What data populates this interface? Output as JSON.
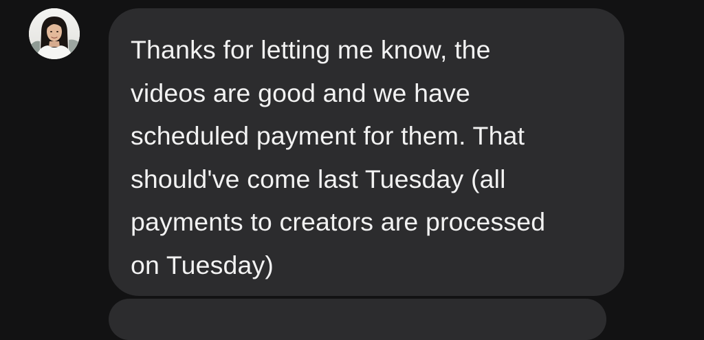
{
  "conversation": {
    "message": {
      "sender_avatar": "avatar-photo-icon",
      "text": "Thanks for letting me know, the\nvideos are good and we have\nscheduled payment for them. That\nshould've come last Tuesday (all\npayments to creators are processed\non Tuesday)"
    }
  },
  "colors": {
    "background": "#121213",
    "bubble": "#2c2c2e",
    "text": "#f2f2f2"
  }
}
